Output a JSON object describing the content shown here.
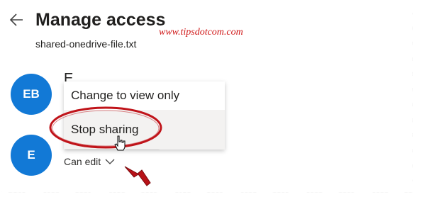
{
  "header": {
    "title": "Manage access",
    "filename": "shared-onedrive-file.txt"
  },
  "watermark": "www.tipsdotcom.com",
  "people": [
    {
      "initials": "EB",
      "name_partial": "E"
    },
    {
      "initials": "E"
    }
  ],
  "menu": {
    "items": [
      {
        "label": "Change to view only"
      },
      {
        "label": "Stop sharing"
      }
    ]
  },
  "permission": {
    "label": "Can edit"
  },
  "icons": {
    "back": "arrow-left-icon",
    "chevron": "chevron-down-icon",
    "cursor": "hand-cursor-icon",
    "arrow": "red-arrow-icon"
  },
  "colors": {
    "avatar": "#1279d6",
    "annotation": "#c0141a",
    "watermark": "#d01818"
  }
}
